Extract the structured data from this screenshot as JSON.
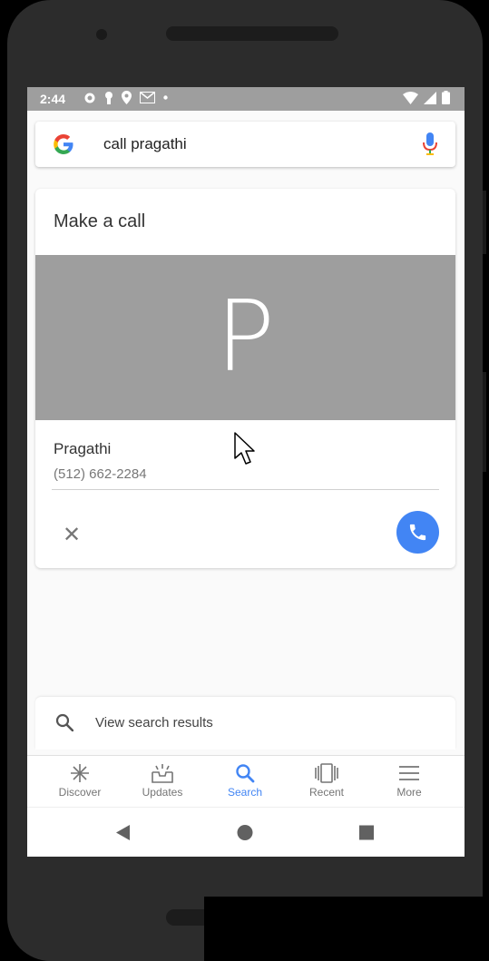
{
  "statusbar": {
    "time": "2:44"
  },
  "search": {
    "query": "call pragathi"
  },
  "card": {
    "title": "Make a call",
    "initial": "P",
    "contact_name": "Pragathi",
    "contact_number": "(512) 662-2284",
    "dismiss_glyph": "✕"
  },
  "results": {
    "label": "View search results"
  },
  "nav": {
    "items": [
      {
        "label": "Discover",
        "icon": "asterisk-icon"
      },
      {
        "label": "Updates",
        "icon": "inbox-icon"
      },
      {
        "label": "Search",
        "icon": "search-icon",
        "active": true
      },
      {
        "label": "Recent",
        "icon": "cards-icon"
      },
      {
        "label": "More",
        "icon": "menu-icon"
      }
    ]
  },
  "colors": {
    "accent": "#4285f4",
    "banner": "#9e9e9e",
    "statusbar": "#9e9e9e"
  }
}
